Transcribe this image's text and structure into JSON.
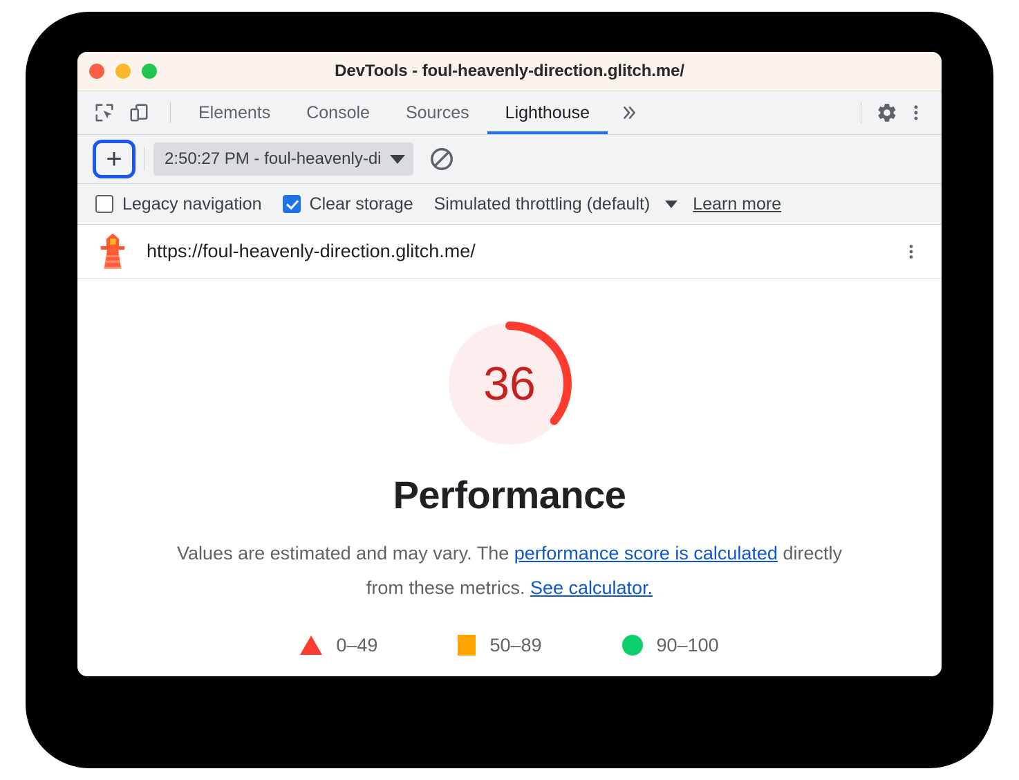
{
  "window": {
    "title": "DevTools - foul-heavenly-direction.glitch.me/",
    "traffic_lights": [
      "close",
      "minimize",
      "maximize"
    ]
  },
  "devtools": {
    "left_icons": [
      {
        "name": "inspect-element-icon",
        "label": "Inspect element"
      },
      {
        "name": "device-toolbar-icon",
        "label": "Toggle device toolbar"
      }
    ],
    "tabs": [
      {
        "label": "Elements",
        "active": false
      },
      {
        "label": "Console",
        "active": false
      },
      {
        "label": "Sources",
        "active": false
      },
      {
        "label": "Lighthouse",
        "active": true
      }
    ],
    "more_tabs": "»",
    "right_icons": [
      {
        "name": "settings-gear-icon",
        "label": "Settings"
      },
      {
        "name": "more-options-icon",
        "label": "Customize and control DevTools"
      }
    ]
  },
  "run_toolbar": {
    "new_report_label": "+",
    "report_select_value": "2:50:27 PM - foul-heavenly-di",
    "clear_all_label": "Clear all"
  },
  "options": {
    "legacy_navigation": {
      "label": "Legacy navigation",
      "checked": false
    },
    "clear_storage": {
      "label": "Clear storage",
      "checked": true
    },
    "throttling": {
      "label": "Simulated throttling (default)"
    },
    "learn_more": "Learn more"
  },
  "report": {
    "icon_name": "lighthouse-icon",
    "url": "https://foul-heavenly-direction.glitch.me/",
    "menu_label": "Report options"
  },
  "score": {
    "value": "36",
    "category": "Performance",
    "description_before": "Values are estimated and may vary. The ",
    "link1": "performance score is calculated",
    "description_middle": " directly from these metrics. ",
    "link2": "See calculator.",
    "gauge_fill_color": "#ff3b30",
    "gauge_track_color": "#fdeeed"
  },
  "legend": [
    {
      "icon": "triangle-fail-icon",
      "range": "0–49",
      "color": "#ff3b30"
    },
    {
      "icon": "square-average-icon",
      "range": "50–89",
      "color": "#ffa400"
    },
    {
      "icon": "circle-pass-icon",
      "range": "90–100",
      "color": "#0cce6b"
    }
  ]
}
